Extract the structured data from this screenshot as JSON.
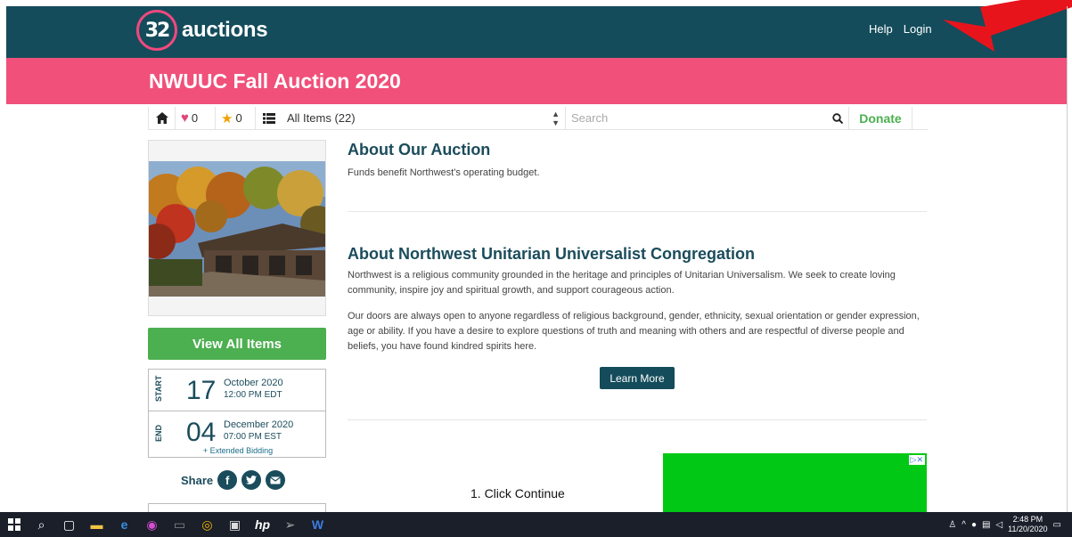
{
  "header": {
    "logo_number": "32",
    "logo_word": "auctions",
    "help_label": "Help",
    "login_label": "Login"
  },
  "banner": {
    "title": "NWUUC Fall Auction 2020"
  },
  "toolbar": {
    "favorites_count": "0",
    "watch_count": "0",
    "category_select": "All Items (22)",
    "search_placeholder": "Search",
    "donate_label": "Donate"
  },
  "sidebar": {
    "view_all_label": "View All Items",
    "start": {
      "label": "START",
      "day": "17",
      "month": "October 2020",
      "time": "12:00 PM EDT"
    },
    "end": {
      "label": "END",
      "day": "04",
      "month": "December 2020",
      "time": "07:00 PM EST"
    },
    "extended_label": "+ Extended Bidding",
    "share_label": "Share",
    "share_icons": [
      "facebook-icon",
      "twitter-icon",
      "email-icon"
    ]
  },
  "main": {
    "about_auction_title": "About Our Auction",
    "about_auction_text": "Funds benefit Northwest's operating budget.",
    "about_org_title": "About Northwest Unitarian Universalist Congregation",
    "about_org_p1": "Northwest is a religious community grounded in the heritage and principles of Unitarian Universalism. We seek to create loving community, inspire joy and spiritual growth, and support courageous action.",
    "about_org_p2": "Our doors are always open to anyone regardless of religious background, gender, ethnicity, sexual orientation or gender expression, age or ability. If you have a desire to explore questions of truth and meaning with others and are respectful of diverse people and beliefs, you have found kindred spirits here.",
    "learn_more_label": "Learn More",
    "ad_text": "1. Click Continue"
  },
  "taskbar": {
    "time": "2:48 PM",
    "date": "11/20/2020"
  },
  "colors": {
    "header_bg": "#144c5b",
    "banner_bg": "#f0507a",
    "accent_green": "#4caf50",
    "arrow_red": "#e8141c"
  }
}
